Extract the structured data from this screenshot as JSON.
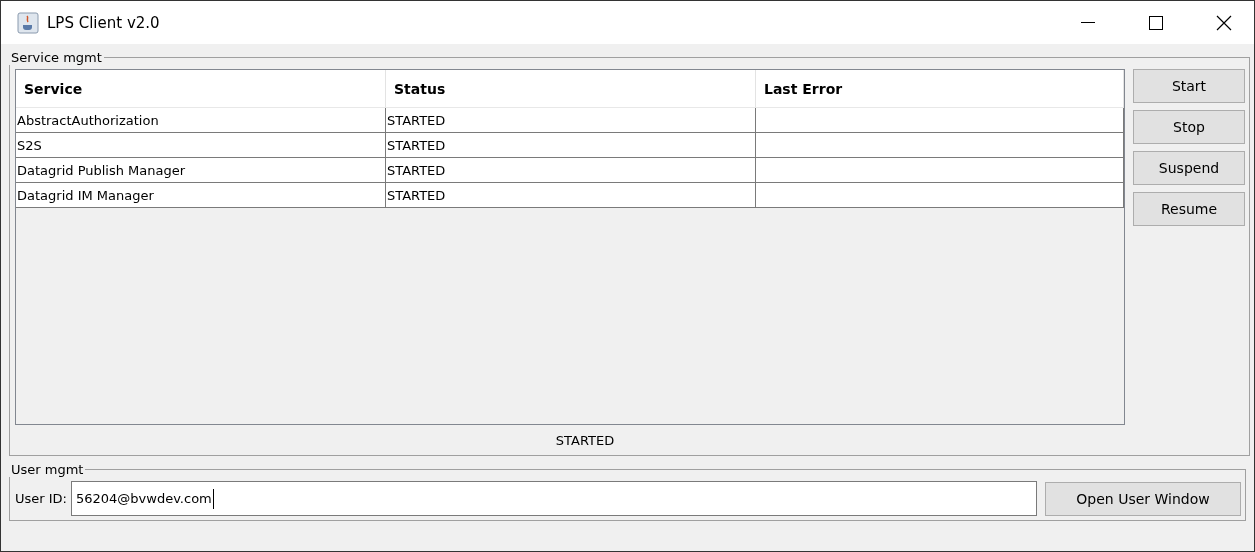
{
  "window": {
    "title": "LPS Client v2.0"
  },
  "service_mgmt": {
    "title": "Service mgmt",
    "table": {
      "columns": [
        "Service",
        "Status",
        "Last Error"
      ],
      "rows": [
        {
          "service": "AbstractAuthorization",
          "status": "STARTED",
          "last_error": ""
        },
        {
          "service": "S2S",
          "status": "STARTED",
          "last_error": ""
        },
        {
          "service": "Datagrid Publish Manager",
          "status": "STARTED",
          "last_error": ""
        },
        {
          "service": "Datagrid IM Manager",
          "status": "STARTED",
          "last_error": ""
        }
      ]
    },
    "buttons": [
      "Start",
      "Stop",
      "Suspend",
      "Resume"
    ],
    "status": "STARTED"
  },
  "user_mgmt": {
    "title": "User mgmt",
    "label": "User ID:",
    "value": "56204@bvwdev.com",
    "button": "Open User Window"
  }
}
